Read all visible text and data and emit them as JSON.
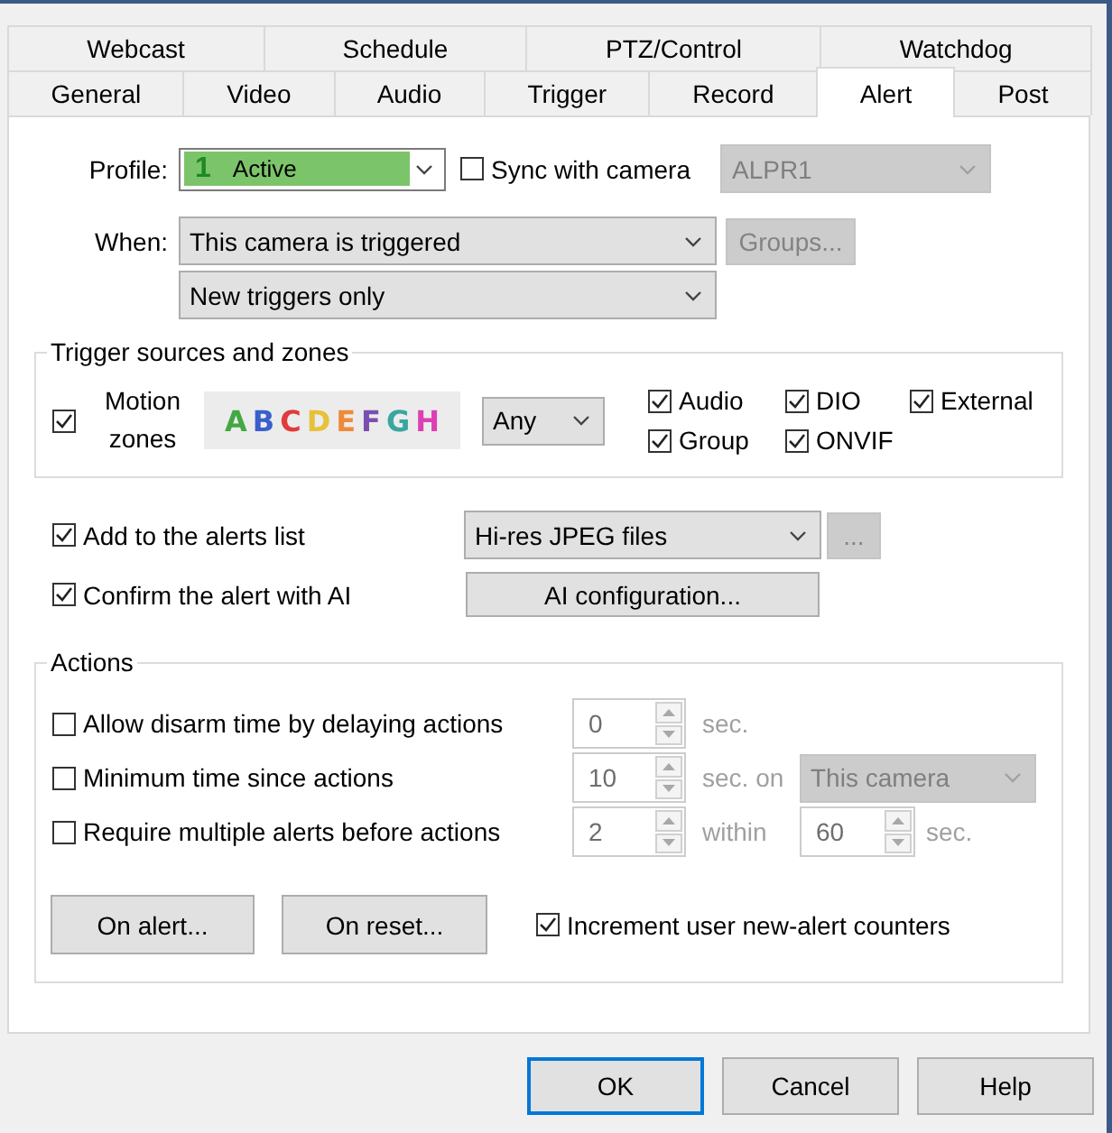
{
  "tab_rows": [
    {
      "tabs": [
        {
          "label": "Webcast",
          "selected": false
        },
        {
          "label": "Schedule",
          "selected": false
        },
        {
          "label": "PTZ/Control",
          "selected": false
        },
        {
          "label": "Watchdog",
          "selected": false
        }
      ]
    },
    {
      "tabs": [
        {
          "label": "General",
          "selected": false
        },
        {
          "label": "Video",
          "selected": false
        },
        {
          "label": "Audio",
          "selected": false
        },
        {
          "label": "Trigger",
          "selected": false
        },
        {
          "label": "Record",
          "selected": false
        },
        {
          "label": "Alert",
          "selected": true
        },
        {
          "label": "Post",
          "selected": false
        }
      ]
    }
  ],
  "profile": {
    "label": "Profile:",
    "number": "1",
    "value": "Active"
  },
  "sync": {
    "label": "Sync with camera",
    "checked": false
  },
  "camera_select": {
    "value": "ALPR1",
    "disabled": true
  },
  "when": {
    "label": "When:",
    "trigger": "This camera is triggered",
    "mode": "New triggers only"
  },
  "groups_button": {
    "label": "Groups...",
    "disabled": true
  },
  "trigger_sources": {
    "title": "Trigger sources and zones",
    "motion": {
      "label": "Motion zones",
      "checked": true
    },
    "zones": [
      {
        "letter": "A",
        "color": "#43a843"
      },
      {
        "letter": "B",
        "color": "#3a5fcd"
      },
      {
        "letter": "C",
        "color": "#e03c3c"
      },
      {
        "letter": "D",
        "color": "#e8c13a"
      },
      {
        "letter": "E",
        "color": "#ee8a3a"
      },
      {
        "letter": "F",
        "color": "#7b4fb0"
      },
      {
        "letter": "G",
        "color": "#3aa6a0"
      },
      {
        "letter": "H",
        "color": "#dc3fb4"
      }
    ],
    "zone_match": "Any",
    "sources": [
      {
        "label": "Audio",
        "checked": true
      },
      {
        "label": "DIO",
        "checked": true
      },
      {
        "label": "External",
        "checked": true
      },
      {
        "label": "Group",
        "checked": true
      },
      {
        "label": "ONVIF",
        "checked": true
      }
    ]
  },
  "alerts_list": {
    "label": "Add to the alerts list",
    "checked": true,
    "format": "Hi-res JPEG files",
    "more_button": {
      "label": "...",
      "disabled": true
    }
  },
  "ai_confirm": {
    "label": "Confirm the alert with AI",
    "checked": true,
    "button": "AI configuration..."
  },
  "actions": {
    "title": "Actions",
    "rows": [
      {
        "kind": "delay",
        "label": "Allow disarm time by delaying actions",
        "checked": false,
        "disabled": true,
        "value": "0",
        "unit": "sec."
      },
      {
        "kind": "scope",
        "label": "Minimum time since actions",
        "checked": false,
        "disabled": true,
        "value": "10",
        "unit": "sec. on",
        "scope": "This camera"
      },
      {
        "kind": "window",
        "label": "Require multiple alerts before actions",
        "checked": false,
        "disabled": true,
        "value": "2",
        "unit": "within",
        "window_value": "60",
        "window_unit": "sec."
      }
    ],
    "buttons": [
      "On alert...",
      "On reset..."
    ],
    "counters": {
      "label": "Increment user new-alert counters",
      "checked": true
    }
  },
  "dialog_buttons": [
    {
      "label": "OK",
      "default": true
    },
    {
      "label": "Cancel",
      "default": false
    },
    {
      "label": "Help",
      "default": false
    }
  ]
}
